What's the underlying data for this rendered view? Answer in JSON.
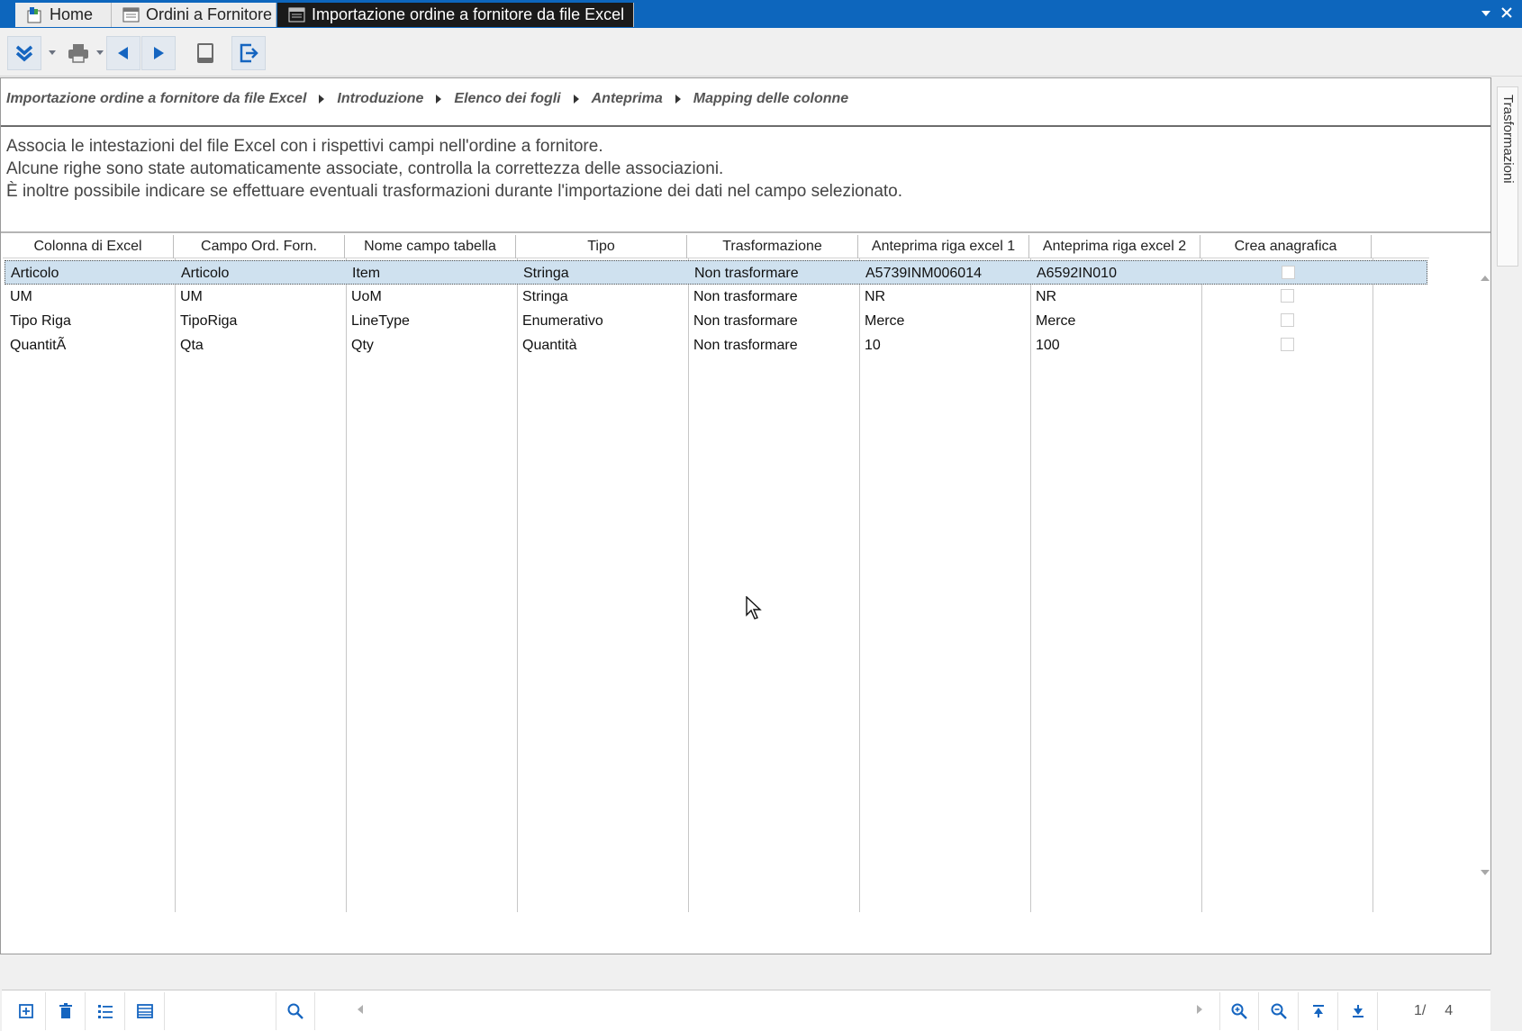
{
  "tabs": [
    {
      "label": "Home"
    },
    {
      "label": "Ordini a Fornitore"
    },
    {
      "label": "Importazione ordine a fornitore da file Excel"
    }
  ],
  "breadcrumb": [
    "Importazione ordine a fornitore da file Excel",
    "Introduzione",
    "Elenco dei fogli",
    "Anteprima",
    "Mapping delle colonne"
  ],
  "info_lines": [
    "Associa le intestazioni del file Excel con i rispettivi campi nell'ordine a fornitore.",
    "Alcune righe sono state automaticamente associate, controlla la correttezza delle associazioni.",
    "È inoltre possibile indicare se effettuare eventuali trasformazioni durante l'importazione dei dati nel campo selezionato."
  ],
  "grid": {
    "columns": [
      "Colonna di Excel",
      "Campo Ord. Forn.",
      "Nome campo tabella",
      "Tipo",
      "Trasformazione",
      "Anteprima riga excel 1",
      "Anteprima riga excel 2",
      "Crea anagrafica"
    ],
    "rows": [
      {
        "excel": "Articolo",
        "campo": "Articolo",
        "nome": "Item",
        "tipo": "Stringa",
        "trasf": "Non trasformare",
        "prev1": "A5739INM006014",
        "prev2": "A6592IN010",
        "crea": false,
        "selected": true
      },
      {
        "excel": "UM",
        "campo": "UM",
        "nome": "UoM",
        "tipo": "Stringa",
        "trasf": "Non trasformare",
        "prev1": "NR",
        "prev2": "NR",
        "crea": false
      },
      {
        "excel": "Tipo Riga",
        "campo": "TipoRiga",
        "nome": "LineType",
        "tipo": "Enumerativo",
        "trasf": "Non trasformare",
        "prev1": "Merce",
        "prev2": "Merce",
        "crea": false
      },
      {
        "excel": "QuantitÃ",
        "campo": "Qta",
        "nome": "Qty",
        "tipo": "Quantità",
        "trasf": "Non trasformare",
        "prev1": "10",
        "prev2": "100",
        "crea": false
      }
    ]
  },
  "pager": {
    "current": "1/",
    "total": "4"
  },
  "side_tab": {
    "label": "Trasformazioni"
  },
  "colors": {
    "titlebar": "#0d66bd",
    "selected_row": "#cfe1ef",
    "icon_blue": "#1565c0"
  }
}
